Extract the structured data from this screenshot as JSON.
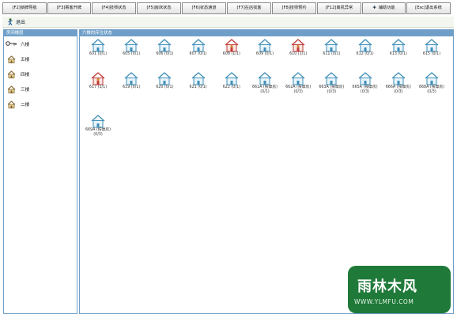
{
  "toolbar": {
    "buttons": [
      {
        "label": "[F2]锁牌导航"
      },
      {
        "label": "[F3]寄客开牌"
      },
      {
        "label": "[F4]技师状态"
      },
      {
        "label": "[F5]房床状态"
      },
      {
        "label": "[F6]状态通道"
      },
      {
        "label": "[F7]在店找客"
      },
      {
        "label": "[F8]技师预约"
      },
      {
        "label": "[F12]离机异常"
      },
      {
        "label": "辅助功能"
      },
      {
        "label": "[Esc]退出系统"
      }
    ]
  },
  "exit_label": "退出",
  "left_panel": {
    "title": "房间楼层",
    "floors": [
      {
        "label": "六楼",
        "selected": true
      },
      {
        "label": "五楼"
      },
      {
        "label": "四楼"
      },
      {
        "label": "三楼"
      },
      {
        "label": "二楼"
      }
    ]
  },
  "right_panel": {
    "title": "六楼的床位状态",
    "rooms": [
      {
        "label": "601 (0/1)",
        "status": "free"
      },
      {
        "label": "605 (0/1)",
        "status": "free"
      },
      {
        "label": "606 (0/1)",
        "status": "free"
      },
      {
        "label": "607 (0/1)",
        "status": "free"
      },
      {
        "label": "608 (1/1)",
        "status": "occupied"
      },
      {
        "label": "609 (0/1)",
        "status": "free"
      },
      {
        "label": "610 (1/1)",
        "status": "occupied"
      },
      {
        "label": "611 (0/1)",
        "status": "free"
      },
      {
        "label": "612 (0/1)",
        "status": "free"
      },
      {
        "label": "613 (0/1)",
        "status": "free"
      },
      {
        "label": "615 (0/1)",
        "status": "free"
      },
      {
        "label": "617 (1/1)",
        "status": "occupied"
      },
      {
        "label": "619 (0/1)",
        "status": "free"
      },
      {
        "label": "620 (0/1)",
        "status": "free"
      },
      {
        "label": "621 (0/1)",
        "status": "free"
      },
      {
        "label": "622 (0/1)",
        "status": "free"
      },
      {
        "label": "661A (按摩房) (0/1)",
        "status": "free"
      },
      {
        "label": "662A (按摩房) (0/3)",
        "status": "free"
      },
      {
        "label": "663A (按摩房) (0/3)",
        "status": "free"
      },
      {
        "label": "665A (按摩房) (0/3)",
        "status": "free"
      },
      {
        "label": "666A (按摩房) (0/3)",
        "status": "free"
      },
      {
        "label": "668A (按摩房) (0/3)",
        "status": "free"
      },
      {
        "label": "669A (按摩房) (0/3)",
        "status": "free"
      }
    ]
  },
  "watermark": {
    "title": "雨林木风",
    "url": "WWW.YLMFU.COM"
  },
  "colors": {
    "accent": "#6f9fc8",
    "house_free": "#3f8fb8",
    "house_busy": "#c23a3a",
    "watermark": "#1f7a3a"
  }
}
